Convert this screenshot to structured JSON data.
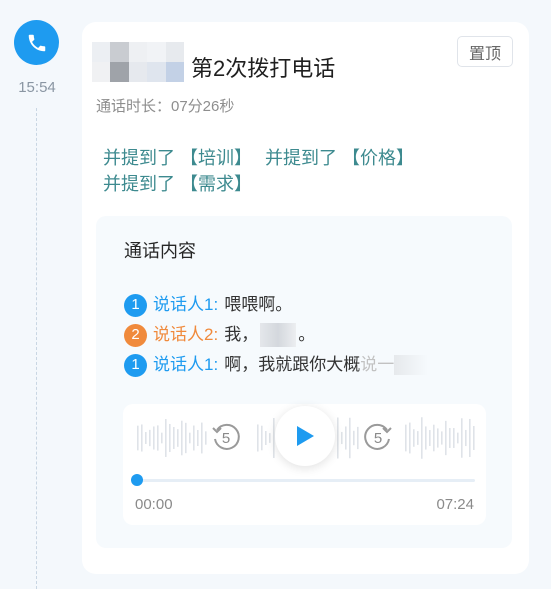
{
  "timeline": {
    "time": "15:54",
    "icon": "phone-icon",
    "accent": "#1e9bf0"
  },
  "card": {
    "title": "第2次拨打电话",
    "pin_label": "置顶",
    "duration": "通话时长：07分26秒",
    "mentions": [
      "并提到了 【培训】",
      "并提到了 【价格】",
      "并提到了 【需求】"
    ]
  },
  "content": {
    "heading": "通话内容",
    "lines": [
      {
        "num": "1",
        "speaker": "说话人1",
        "colon": ":",
        "text": "喂喂啊。",
        "color": "#1e9bf0"
      },
      {
        "num": "2",
        "speaker": "说话人2",
        "colon": ":",
        "text_before": "我，",
        "text_after": "。",
        "color": "#f08a3c"
      },
      {
        "num": "1",
        "speaker": "说话人1",
        "colon": ":",
        "text": "啊，我就跟你大概",
        "text_fade": "说一",
        "color": "#1e9bf0"
      }
    ]
  },
  "player": {
    "skip_back": "5",
    "skip_forward": "5",
    "current": "00:00",
    "total": "07:24",
    "progress": 0.0
  }
}
